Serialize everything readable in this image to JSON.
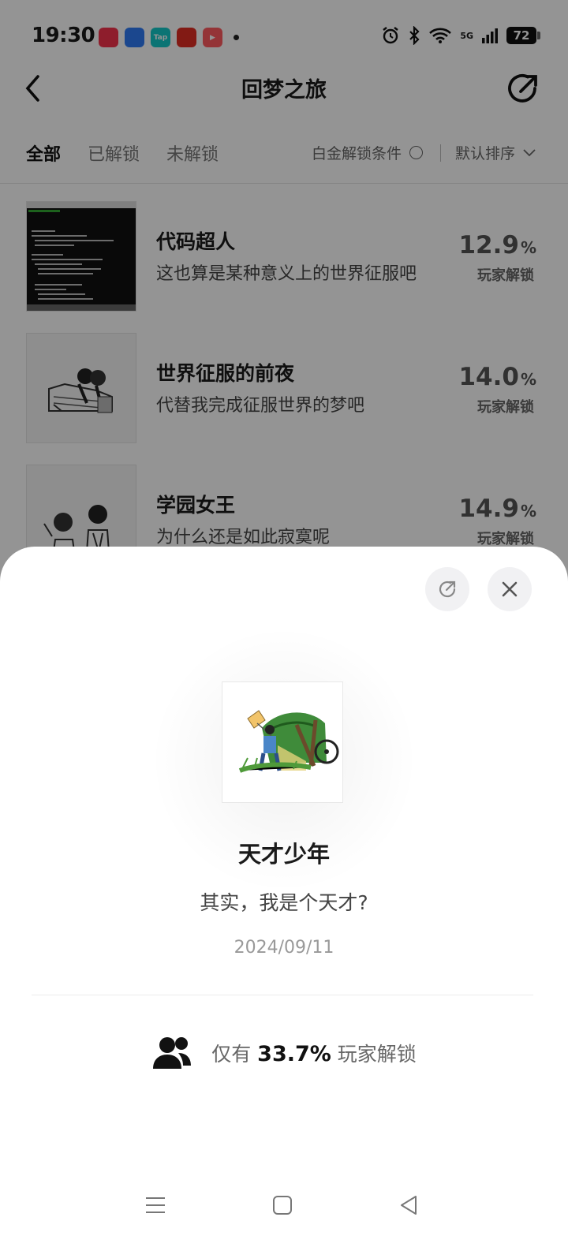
{
  "status_bar": {
    "time": "19:30",
    "apps": [
      {
        "icon": "kuaishou-icon",
        "color": "#f5334d",
        "text": ""
      },
      {
        "icon": "browser-icon",
        "color": "#2f7bf5",
        "text": ""
      },
      {
        "icon": "taptap-icon",
        "color": "#14c8c8",
        "text": "Tap"
      },
      {
        "icon": "pdd-icon",
        "color": "#e02e24",
        "text": ""
      },
      {
        "icon": "video-icon",
        "color": "#ff5a5f",
        "text": "▶"
      }
    ],
    "network_label": "5G",
    "battery": "72"
  },
  "header": {
    "title": "回梦之旅"
  },
  "tabs": [
    {
      "label": "全部",
      "active": true
    },
    {
      "label": "已解锁",
      "active": false
    },
    {
      "label": "未解锁",
      "active": false
    }
  ],
  "filter": {
    "platinum_label": "白金解锁条件",
    "sort_label": "默认排序"
  },
  "achievements": [
    {
      "title": "代码超人",
      "desc": "这也算是某种意义上的世界征服吧",
      "pct": "12.9",
      "unit": "%",
      "pct_label": "玩家解锁"
    },
    {
      "title": "世界征服的前夜",
      "desc": "代替我完成征服世界的梦吧",
      "pct": "14.0",
      "unit": "%",
      "pct_label": "玩家解锁"
    },
    {
      "title": "学园女王",
      "desc": "为什么还是如此寂寞呢",
      "pct": "14.9",
      "unit": "%",
      "pct_label": "玩家解锁"
    }
  ],
  "detail": {
    "title": "天才少年",
    "desc": "其实，我是个天才?",
    "date": "2024/09/11",
    "stat_prefix": "仅有",
    "stat_value": "33.7%",
    "stat_suffix": "玩家解锁"
  },
  "colors": {
    "overlay": "#000000",
    "sheet": "#ffffff"
  }
}
